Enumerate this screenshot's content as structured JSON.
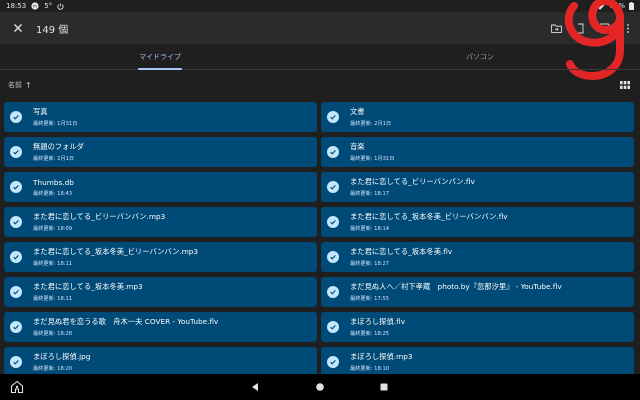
{
  "status": {
    "time": "18:53",
    "temp": "5°",
    "battery": "86%"
  },
  "app_bar": {
    "selected_count": "149 個"
  },
  "tabs": [
    {
      "label": "マイドライブ"
    },
    {
      "label": "パソコン"
    }
  ],
  "sort": {
    "label": "名前"
  },
  "files": [
    {
      "name": "写真",
      "date": "最終更新: 1月31日"
    },
    {
      "name": "文書",
      "date": "最終更新: 2月1日"
    },
    {
      "name": "無題のフォルダ",
      "date": "最終更新: 2月1日"
    },
    {
      "name": "音楽",
      "date": "最終更新: 1月31日"
    },
    {
      "name": "Thumbs.db",
      "date": "最終更新: 18:43"
    },
    {
      "name": "また君に恋してる_ビリーバンバン.flv",
      "date": "最終更新: 18:17"
    },
    {
      "name": "また君に恋してる_ビリーバンバン.mp3",
      "date": "最終更新: 18:09"
    },
    {
      "name": "また君に恋してる_坂本冬美_ビリーバンバン.flv",
      "date": "最終更新: 18:14"
    },
    {
      "name": "また君に恋してる_坂本冬美_ビリーバンバン.mp3",
      "date": "最終更新: 18:11"
    },
    {
      "name": "また君に恋してる_坂本冬美.flv",
      "date": "最終更新: 18:27"
    },
    {
      "name": "また君に恋してる_坂本冬美.mp3",
      "date": "最終更新: 18:11"
    },
    {
      "name": "まだ見ぬ人へ／村下孝蔵　photo.by『忽那汐里』 - YouTube.flv",
      "date": "最終更新: 17:55"
    },
    {
      "name": "まだ見ぬ君を恋うる歌　舟木一夫 COVER - YouTube.flv",
      "date": "最終更新: 18:28"
    },
    {
      "name": "まぼろし探偵.flv",
      "date": "最終更新: 18:25"
    },
    {
      "name": "まぼろし探偵.jpg",
      "date": "最終更新: 18:20"
    },
    {
      "name": "まぼろし探偵.mp3",
      "date": "最終更新: 18:10"
    }
  ]
}
